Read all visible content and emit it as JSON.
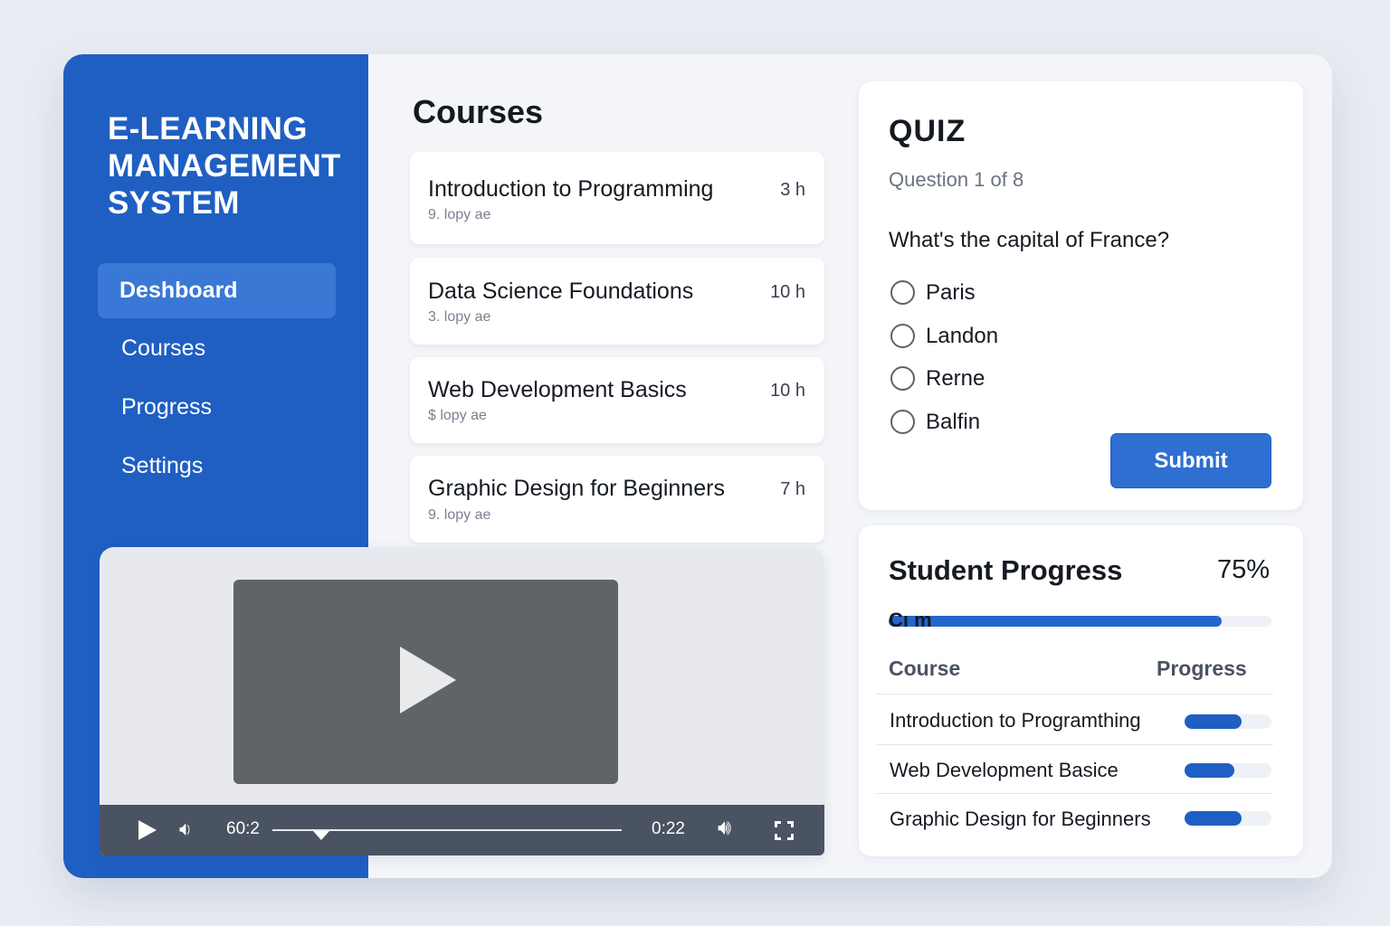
{
  "sidebar": {
    "brand": "E-LEARNING\nMANAGEMENT\nSYSTEM",
    "items": [
      {
        "label": "Deshboard",
        "active": true
      },
      {
        "label": "Courses",
        "active": false
      },
      {
        "label": "Progress",
        "active": false
      },
      {
        "label": "Settings",
        "active": false
      }
    ]
  },
  "courses": {
    "title": "Courses",
    "items": [
      {
        "name": "Introduction to Programming",
        "hours": "3 h",
        "sub": "9. lopy ae"
      },
      {
        "name": "Data Science Foundations",
        "hours": "10 h",
        "sub": "3. lopy ae"
      },
      {
        "name": "Web Development Basics",
        "hours": "10 h",
        "sub": "$ lopy ae"
      },
      {
        "name": "Graphic Design for Beginners",
        "hours": "7 h",
        "sub": "9. lopy ae"
      }
    ]
  },
  "video": {
    "current_time": "60:2",
    "duration": "0:22",
    "seek_fraction": 0.14,
    "icons": [
      "play-icon",
      "volume-icon",
      "volume-high-icon",
      "fullscreen-icon"
    ]
  },
  "quiz": {
    "title": "QUIZ",
    "counter": "Question 1 of 8",
    "question": "What's the capital of France?",
    "options": [
      "Paris",
      "Landon",
      "Rerne",
      "Balfin"
    ],
    "submit_label": "Submit"
  },
  "progress": {
    "title": "Student Progress",
    "percent_label": "75%",
    "overall_fraction": 0.87,
    "bar_label": "Cı m",
    "columns": [
      "Course",
      "Progress"
    ],
    "rows": [
      {
        "course": "Introduction to Programthing",
        "fraction": 0.66
      },
      {
        "course": "Web Development Basice",
        "fraction": 0.57
      },
      {
        "course": "Graphic Design for Beginners",
        "fraction": 0.66
      }
    ]
  },
  "colors": {
    "primary": "#1f5fc2",
    "accent": "#2f6fd1"
  }
}
